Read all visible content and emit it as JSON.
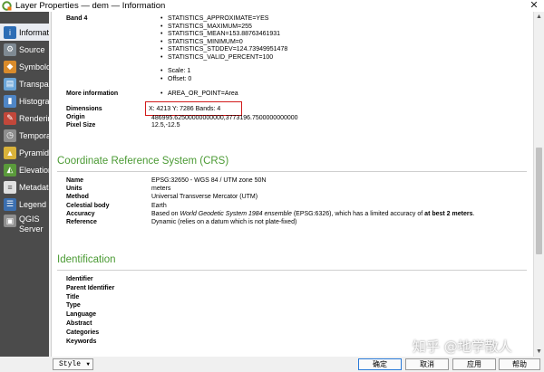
{
  "window": {
    "title": "Layer Properties — dem — Information",
    "close_glyph": "✕"
  },
  "sidebar": {
    "items": [
      {
        "label": "Informat",
        "icon": "info-icon",
        "color": "#2d6db5",
        "glyph": "i"
      },
      {
        "label": "Source",
        "icon": "source-gear-icon",
        "color": "#7f8a93",
        "glyph": "⚙"
      },
      {
        "label": "Symbolo",
        "icon": "symbology-icon",
        "color": "#d98b2b",
        "glyph": "◆"
      },
      {
        "label": "Transpar",
        "icon": "transparency-icon",
        "color": "#6aa5d8",
        "glyph": "▤"
      },
      {
        "label": "Histogra",
        "icon": "histogram-icon",
        "color": "#4f86c6",
        "glyph": "▮"
      },
      {
        "label": "Renderin",
        "icon": "rendering-brush-icon",
        "color": "#c2473a",
        "glyph": "✎"
      },
      {
        "label": "Tempora",
        "icon": "temporal-clock-icon",
        "color": "#8e8e8e",
        "glyph": "◷"
      },
      {
        "label": "Pyramids",
        "icon": "pyramids-icon",
        "color": "#d9b23a",
        "glyph": "▲"
      },
      {
        "label": "Elevation",
        "icon": "elevation-icon",
        "color": "#5a9a3b",
        "glyph": "◭"
      },
      {
        "label": "Metadata",
        "icon": "metadata-icon",
        "color": "#e0e0e0",
        "glyph": "≡"
      },
      {
        "label": "Legend",
        "icon": "legend-icon",
        "color": "#3b6fb0",
        "glyph": "☰"
      },
      {
        "label": "QGIS Server",
        "icon": "qgis-server-icon",
        "color": "#8e8e8e",
        "glyph": "▣"
      }
    ]
  },
  "band4": {
    "label": "Band 4",
    "stats": [
      "STATISTICS_APPROXIMATE=YES",
      "STATISTICS_MAXIMUM=255",
      "STATISTICS_MEAN=153.88763461931",
      "STATISTICS_MINIMUM=0",
      "STATISTICS_STDDEV=124.73949951478",
      "STATISTICS_VALID_PERCENT=100"
    ],
    "scale": "Scale: 1",
    "offset": "Offset: 0"
  },
  "info": {
    "more_info_label": "More information",
    "more_info_value": "AREA_OR_POINT=Area",
    "dimensions_label": "Dimensions",
    "dimensions_value": "X: 4213 Y: 7286 Bands: 4",
    "origin_label": "Origin",
    "origin_value": "486995.62500000000000,3773196.7500000000000",
    "pixel_size_label": "Pixel Size",
    "pixel_size_value": "12.5,-12.5"
  },
  "crs": {
    "title": "Coordinate Reference System (CRS)",
    "name_label": "Name",
    "name_value": "EPSG:32650 - WGS 84 / UTM zone 50N",
    "units_label": "Units",
    "units_value": "meters",
    "method_label": "Method",
    "method_value": "Universal Transverse Mercator (UTM)",
    "celestial_label": "Celestial body",
    "celestial_value": "Earth",
    "accuracy_label": "Accuracy",
    "accuracy_pre": "Based on ",
    "accuracy_italic": "World Geodetic System 1984 ensemble",
    "accuracy_mid": " (EPSG:6326), which has a limited accuracy of ",
    "accuracy_bold": "at best 2 meters",
    "accuracy_end": ".",
    "reference_label": "Reference",
    "reference_value": "Dynamic (relies on a datum which is not plate-fixed)"
  },
  "identification": {
    "title": "Identification",
    "fields": [
      "Identifier",
      "Parent Identifier",
      "Title",
      "Type",
      "Language",
      "Abstract",
      "Categories",
      "Keywords"
    ]
  },
  "bottom": {
    "style_label": "Style",
    "ok_label": "确定",
    "cancel_label": "取消",
    "apply_label": "应用",
    "help_label": "帮助"
  },
  "watermark": "知乎 @地学散人"
}
